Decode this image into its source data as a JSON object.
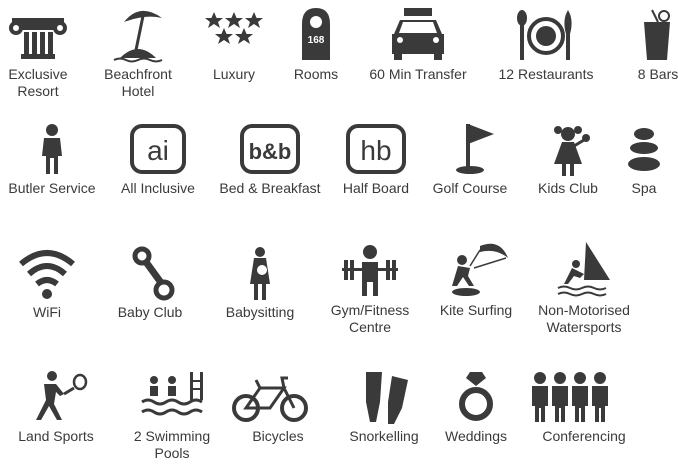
{
  "icons": [
    {
      "icon": "greek-column-icon",
      "label": "Exclusive\nResort"
    },
    {
      "icon": "beach-umbrella-icon",
      "label": "Beachfront\nHotel"
    },
    {
      "icon": "stars-icon",
      "label": "Luxury"
    },
    {
      "icon": "door-hanger-icon",
      "label": "Rooms",
      "badge": "168"
    },
    {
      "icon": "taxi-icon",
      "label": "60 Min Transfer"
    },
    {
      "icon": "plate-cutlery-icon",
      "label": "12 Restaurants"
    },
    {
      "icon": "drink-glass-icon",
      "label": "8 Bars"
    },
    {
      "icon": "butler-icon",
      "label": "Butler Service"
    },
    {
      "icon": "all-inclusive-icon",
      "label": "All Inclusive",
      "badge": "ai"
    },
    {
      "icon": "bed-breakfast-icon",
      "label": "Bed & Breakfast",
      "badge": "b&b"
    },
    {
      "icon": "half-board-icon",
      "label": "Half Board",
      "badge": "hb"
    },
    {
      "icon": "golf-flag-icon",
      "label": "Golf Course"
    },
    {
      "icon": "kids-club-icon",
      "label": "Kids Club"
    },
    {
      "icon": "spa-stones-icon",
      "label": "Spa"
    },
    {
      "icon": "wifi-icon",
      "label": "WiFi"
    },
    {
      "icon": "baby-rattle-icon",
      "label": "Baby Club"
    },
    {
      "icon": "babysitter-icon",
      "label": "Babysitting"
    },
    {
      "icon": "weightlifter-icon",
      "label": "Gym/Fitness\nCentre"
    },
    {
      "icon": "kite-surfer-icon",
      "label": "Kite Surfing"
    },
    {
      "icon": "windsurfer-icon",
      "label": "Non-Motorised\nWatersports"
    },
    {
      "icon": "tennis-player-icon",
      "label": "Land Sports"
    },
    {
      "icon": "swimming-pool-icon",
      "label": "2 Swimming\nPools"
    },
    {
      "icon": "bicycle-icon",
      "label": "Bicycles"
    },
    {
      "icon": "flippers-icon",
      "label": "Snorkelling"
    },
    {
      "icon": "diamond-ring-icon",
      "label": "Weddings"
    },
    {
      "icon": "conference-people-icon",
      "label": "Conferencing"
    }
  ],
  "colors": {
    "icon": "#3a3a3a",
    "text": "#3a3a3a",
    "background": "#ffffff"
  }
}
